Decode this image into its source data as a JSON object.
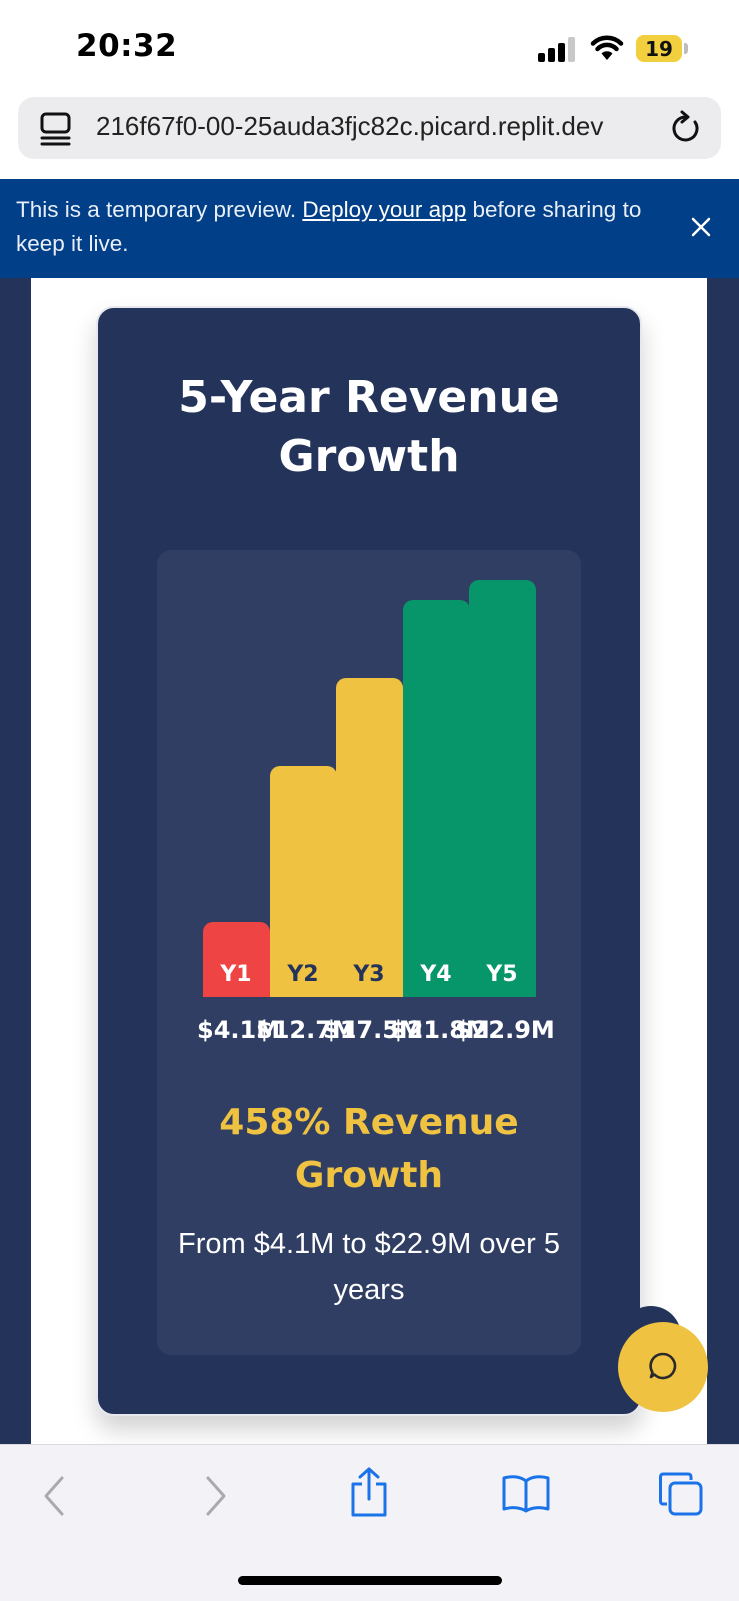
{
  "status_bar": {
    "time": "20:32",
    "battery": "19"
  },
  "browser": {
    "url": "216f67f0-00-25auda3fjc82c.picard.replit.dev"
  },
  "banner": {
    "text_before": "This is a temporary preview. ",
    "link": "Deploy your app",
    "text_after": " before sharing to keep it live."
  },
  "card": {
    "title": "5-Year Revenue Growth",
    "growth_headline": "458% Revenue Growth",
    "growth_detail": "From $4.1M to $22.9M over 5 years"
  },
  "chart_data": {
    "type": "bar",
    "categories": [
      "Y1",
      "Y2",
      "Y3",
      "Y4",
      "Y5"
    ],
    "values": [
      4.1,
      12.7,
      17.5,
      21.8,
      22.9
    ],
    "value_labels": [
      "$4.1M",
      "$12.7M",
      "$17.5M",
      "$21.8M",
      "$22.9M"
    ],
    "unit": "$M",
    "ylim": [
      0,
      25
    ],
    "colors": [
      "#ef4444",
      "#f0c242",
      "#f0c242",
      "#079669",
      "#079669"
    ],
    "label_colors": [
      "#ffffff",
      "#24335a",
      "#24335a",
      "#ffffff",
      "#ffffff"
    ],
    "title": "",
    "xlabel": "",
    "ylabel": ""
  },
  "colors": {
    "page_bg": "#24335a",
    "panel_bg": "#303e63",
    "accent_yellow": "#f0c242",
    "banner_bg": "#013f88"
  },
  "icons": {
    "tabs": "tabs-icon",
    "reload": "reload-icon",
    "close": "close-icon",
    "chat": "chat-bubble-icon",
    "back": "back-arrow-icon",
    "forward": "forward-arrow-icon",
    "share": "share-icon",
    "bookmarks": "book-icon",
    "tab_overview": "tab-overview-icon"
  }
}
